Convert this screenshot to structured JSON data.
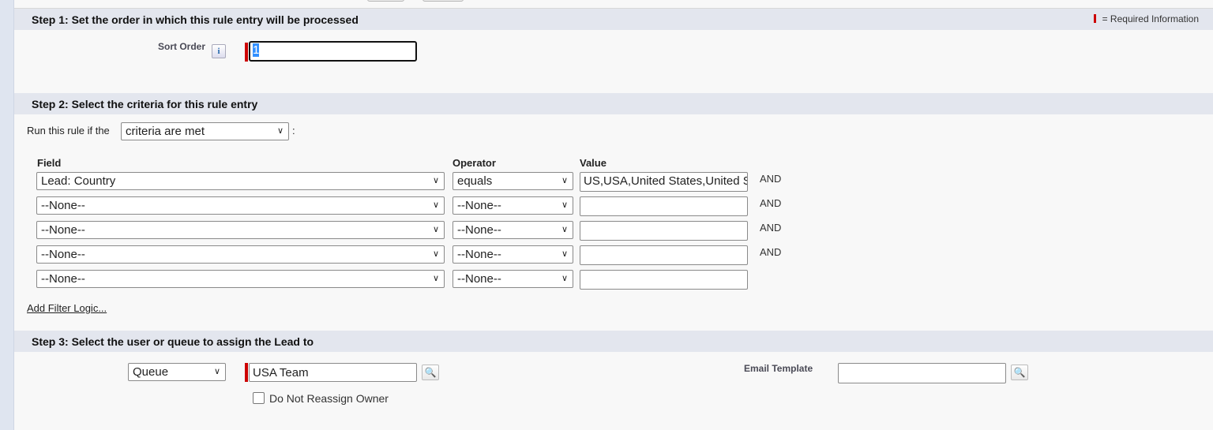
{
  "required_note": "= Required Information",
  "step1": {
    "title": "Step 1: Set the order in which this rule entry will be processed",
    "sort_order_label": "Sort Order",
    "sort_order_value": "1"
  },
  "step2": {
    "title": "Step 2: Select the criteria for this rule entry",
    "run_prefix": "Run this rule if the",
    "run_select": "criteria are met",
    "run_suffix": ":",
    "headers": {
      "field": "Field",
      "operator": "Operator",
      "value": "Value"
    },
    "rows": [
      {
        "field": "Lead: Country",
        "operator": "equals",
        "value": "US,USA,United States,United States of America",
        "join": "AND"
      },
      {
        "field": "--None--",
        "operator": "--None--",
        "value": "",
        "join": "AND"
      },
      {
        "field": "--None--",
        "operator": "--None--",
        "value": "",
        "join": "AND"
      },
      {
        "field": "--None--",
        "operator": "--None--",
        "value": "",
        "join": "AND"
      },
      {
        "field": "--None--",
        "operator": "--None--",
        "value": "",
        "join": ""
      }
    ],
    "filter_logic_link": "Add Filter Logic..."
  },
  "step3": {
    "title": "Step 3: Select the user or queue to assign the Lead to",
    "assign_type": "Queue",
    "assignee": "USA Team",
    "do_not_reassign_label": "Do Not Reassign Owner",
    "do_not_reassign_checked": false,
    "email_template_label": "Email Template",
    "email_template_value": ""
  },
  "colors": {
    "required": "#cc0000",
    "section_header": "#e3e6ee"
  }
}
